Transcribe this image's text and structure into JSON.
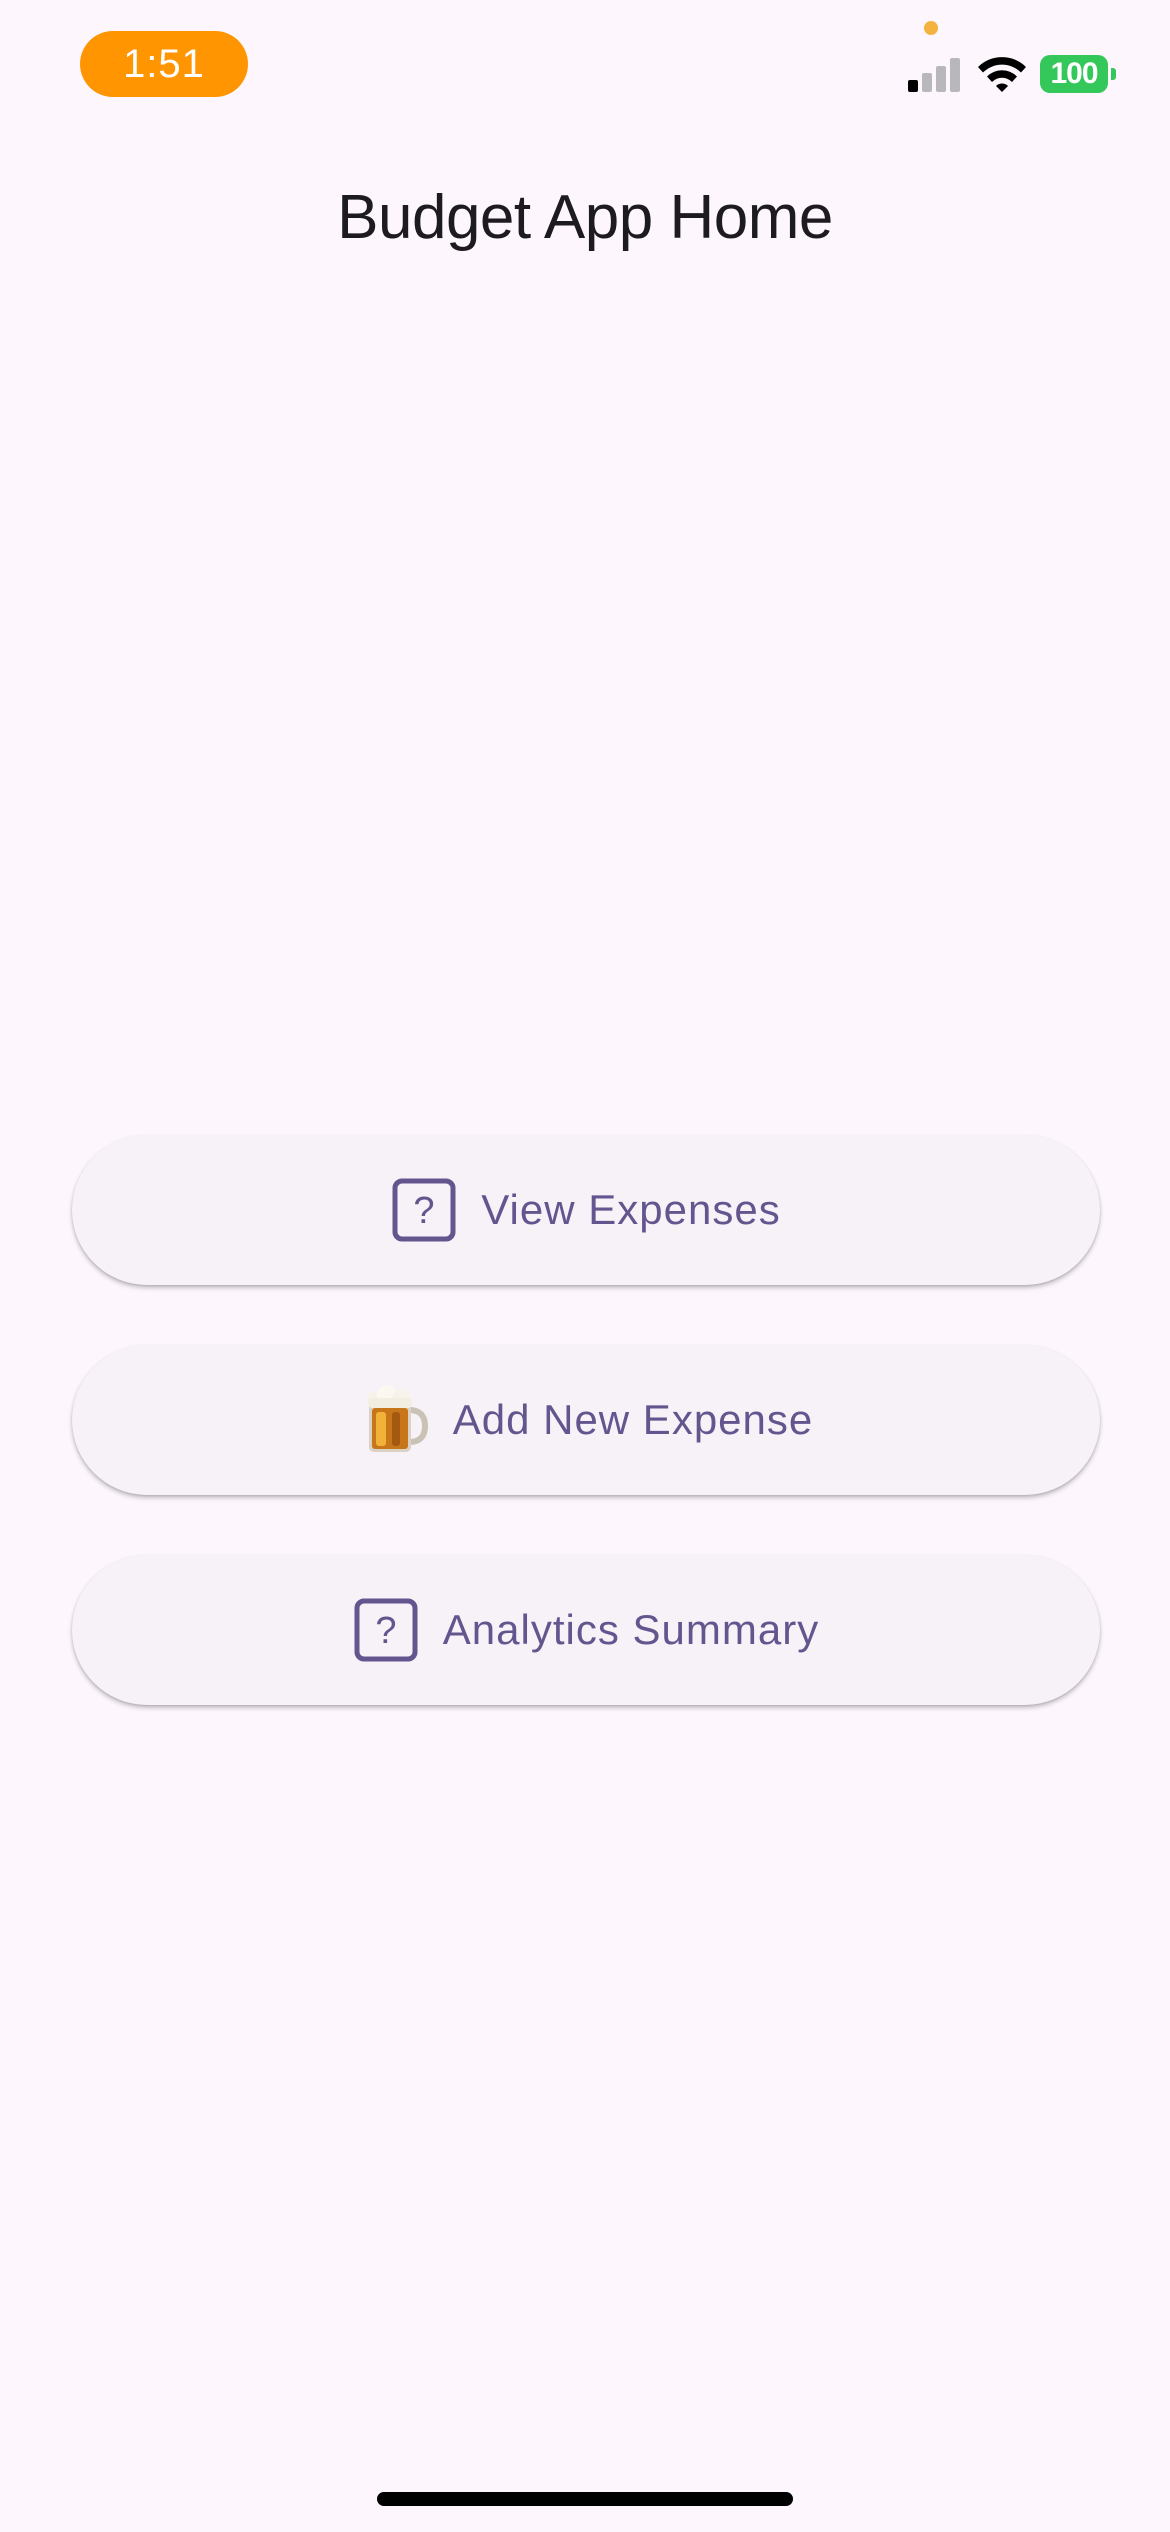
{
  "status_bar": {
    "time": "1:51",
    "battery": "100",
    "colors": {
      "time_pill": "#ff9500",
      "privacy_dot": "#f4b23e",
      "signal_active": "#000000",
      "signal_inactive": "#b8b8bc",
      "battery": "#34c759"
    },
    "signal_bars_active": 1,
    "signal_bars_total": 4
  },
  "app_bar": {
    "title": "Budget App Home"
  },
  "buttons": [
    {
      "label": "View Expenses",
      "icon": "question-box-icon"
    },
    {
      "label": "Add New Expense",
      "icon": "beer-mug-icon"
    },
    {
      "label": "Analytics Summary",
      "icon": "question-box-icon"
    }
  ],
  "colors": {
    "background": "#fdf7fd",
    "button_bg": "#f6f2f8",
    "accent": "#65558f",
    "title_text": "#1d1b20"
  }
}
